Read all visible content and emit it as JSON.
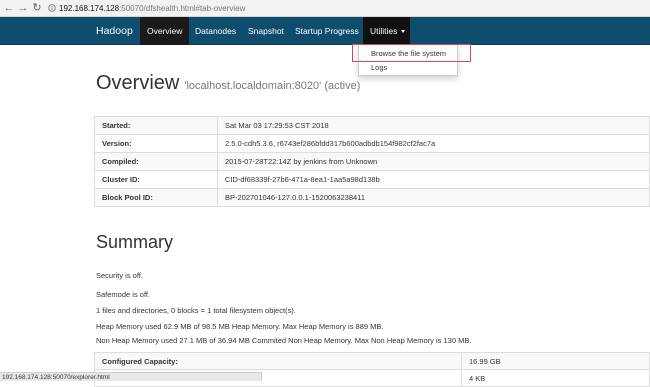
{
  "browser": {
    "url_host": "192.168.174.128",
    "url_path": ":50070/dfshealth.html#tab-overview",
    "status_url": "192.168.174.128:50070/explorer.html"
  },
  "navbar": {
    "brand": "Hadoop",
    "items": [
      {
        "label": "Overview"
      },
      {
        "label": "Datanodes"
      },
      {
        "label": "Snapshot"
      },
      {
        "label": "Startup Progress"
      },
      {
        "label": "Utilities"
      }
    ],
    "active_color": "#1a1a1a",
    "bar_color": "#0e4d6e"
  },
  "utilities_menu": {
    "items": [
      {
        "label": "Browse the file system"
      },
      {
        "label": "Logs"
      }
    ]
  },
  "overview": {
    "title": "Overview",
    "subtitle": "'localhost.localdomain:8020' (active)",
    "rows": [
      {
        "key": "Started:",
        "value": "Sat Mar 03 17:29:53 CST 2018"
      },
      {
        "key": "Version:",
        "value": "2.5.0-cdh5.3.6, r6743ef286bfdd317b600adbdb154f982cf2fac7a"
      },
      {
        "key": "Compiled:",
        "value": "2015-07-28T22:14Z by jenkins from Unknown"
      },
      {
        "key": "Cluster ID:",
        "value": "CID-df68339f-27b6-471a-8ea1-1aa5a98d138b"
      },
      {
        "key": "Block Pool ID:",
        "value": "BP-202701046-127.0.0.1-1520063238411"
      }
    ]
  },
  "summary": {
    "title": "Summary",
    "lines": [
      "Security is off.",
      "Safemode is off.",
      "1 files and directories, 0 blocks = 1 total filesystem object(s).",
      "Heap Memory used 62.9 MB of 98.5 MB Heap Memory. Max Heap Memory is 889 MB.",
      "Non Heap Memory used 27.1 MB of 36.94 MB Commited Non Heap Memory. Max Non Heap Memory is 130 MB."
    ],
    "capacity_rows": [
      {
        "key": "Configured Capacity:",
        "value": "16.99 GB"
      },
      {
        "key": "",
        "value": "4 KB"
      }
    ]
  }
}
